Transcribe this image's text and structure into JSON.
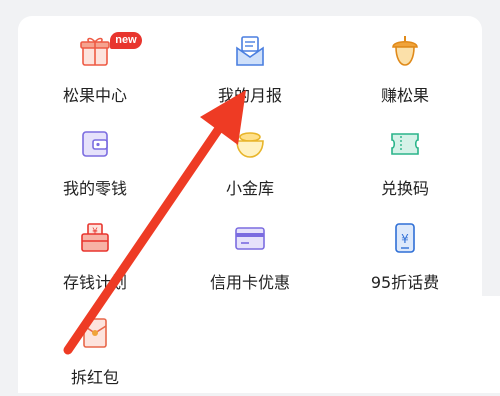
{
  "grid": {
    "items": [
      {
        "label": "松果中心",
        "icon": "gift-box-icon"
      },
      {
        "label": "我的月报",
        "icon": "envelope-report-icon"
      },
      {
        "label": "赚松果",
        "icon": "acorn-icon"
      },
      {
        "label": "我的零钱",
        "icon": "wallet-icon"
      },
      {
        "label": "小金库",
        "icon": "vault-bowl-icon"
      },
      {
        "label": "兑换码",
        "icon": "ticket-icon"
      },
      {
        "label": "存钱计划",
        "icon": "piggy-bank-icon"
      },
      {
        "label": "信用卡优惠",
        "icon": "credit-card-icon"
      },
      {
        "label": "95折话费",
        "icon": "phone-bill-icon"
      },
      {
        "label": "拆红包",
        "icon": "red-packet-icon"
      }
    ],
    "badge": "new"
  },
  "colors": {
    "accent_red": "#e8352e",
    "orange": "#f0a33a",
    "blue": "#4a7fe0",
    "purple": "#7b6ce0",
    "green": "#2bb48a",
    "text": "#222222"
  }
}
